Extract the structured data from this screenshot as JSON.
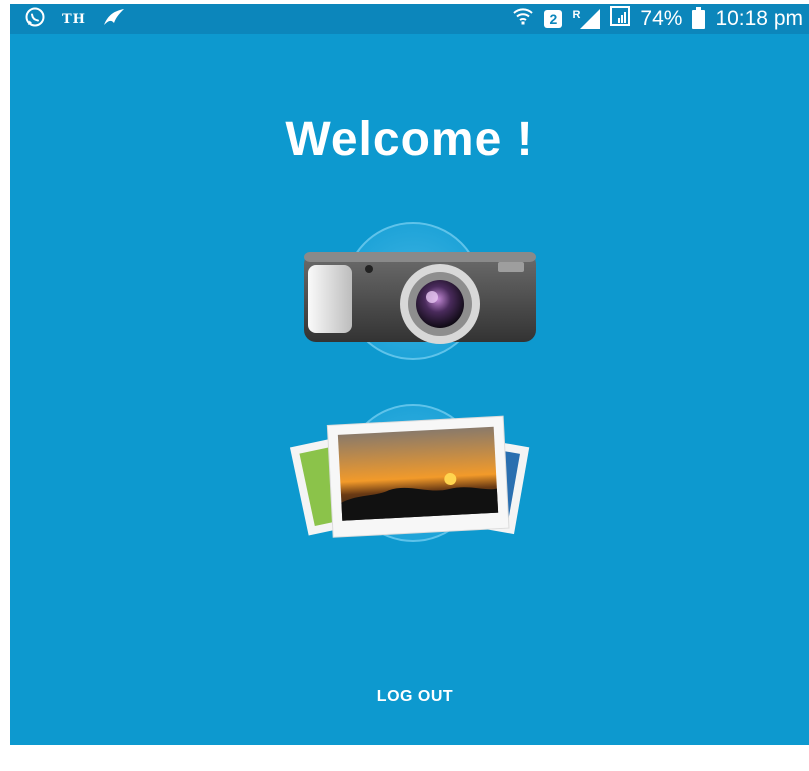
{
  "status_bar": {
    "left_text": "TH",
    "sim_number": "2",
    "roaming_label": "R",
    "battery_percent": "74%",
    "time": "10:18 pm",
    "icons": [
      "whatsapp-icon",
      "hangouts-icon",
      "wifi-icon",
      "sim-icon",
      "signal-icon",
      "battery-icon"
    ]
  },
  "main": {
    "title": "Welcome !",
    "camera_button_icon": "camera-icon",
    "gallery_button_icon": "photo-gallery-icon"
  },
  "logout_label": "LOG OUT",
  "colors": {
    "background": "#0d99cf",
    "status_bar": "#0c86bb",
    "text": "#ffffff"
  }
}
